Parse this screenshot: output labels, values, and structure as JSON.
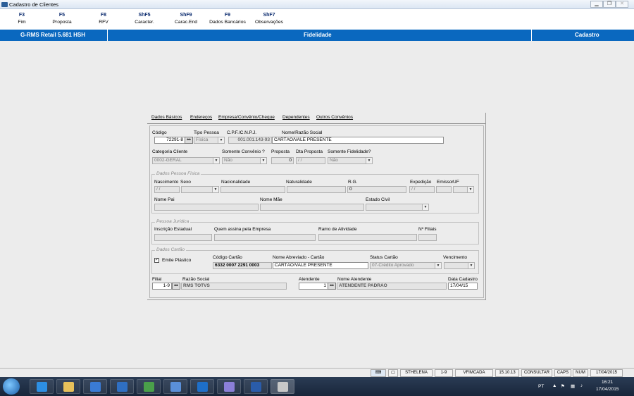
{
  "window": {
    "title": "Cadastro de Clientes"
  },
  "fkeys": [
    {
      "key": "F3",
      "label": "Fim"
    },
    {
      "key": "F5",
      "label": "Proposta"
    },
    {
      "key": "F8",
      "label": "RFV"
    },
    {
      "key": "ShF5",
      "label": "Caracter."
    },
    {
      "key": "ShF9",
      "label": "Carac.End"
    },
    {
      "key": "F9",
      "label": "Dados Bancários"
    },
    {
      "key": "ShF7",
      "label": "Observações"
    }
  ],
  "header": {
    "app": "G-RMS Retail 5.681 HSH",
    "module": "Fidelidade",
    "mode": "Cadastro"
  },
  "tabs": [
    "Dados Básicos",
    "Endereços",
    "Empresa/Convênio/Cheque",
    "Dependentes",
    "Outros Convênios"
  ],
  "basic": {
    "codigo_label": "Código",
    "codigo": "72291-8",
    "tipo_label": "Tipo Pessoa",
    "tipo": "Física",
    "cpf_label": "C.P.F./C.N.P.J.",
    "cpf": "001.001.143-93",
    "nome_label": "Nome/Razão Social",
    "nome": "CARTÃO/VALE PRESENTE",
    "categoria_label": "Categoria Cliente",
    "categoria": "0002-GERAL",
    "convenio_label": "Somente Convênio ?",
    "convenio": "Não",
    "proposta_label": "Proposta",
    "proposta": "0",
    "dtproposta_label": "Dta Proposta",
    "dtproposta": "/ /",
    "fidelidade_label": "Somente Fidelidade?",
    "fidelidade": "Não"
  },
  "pf": {
    "title": "Dados Pessoa Física",
    "nascimento_label": "Nascimento",
    "nascimento": "/ /",
    "sexo_label": "Sexo",
    "nacionalidade_label": "Nacionalidade",
    "naturalidade_label": "Naturalidade",
    "rg_label": "R.G.",
    "rg": "0",
    "expedicao_label": "Expedição",
    "expedicao": "/ /",
    "emissor_label": "Emissor",
    "uf_label": "UF",
    "pai_label": "Nome Pai",
    "mae_label": "Nome Mãe",
    "civil_label": "Estado Civil"
  },
  "pj": {
    "title": "Pessoa Jurídica",
    "ie_label": "Inscrição Estadual",
    "assina_label": "Quem assina pela Empresa",
    "ramo_label": "Ramo de Atividade",
    "filiais_label": "Nº Filiais"
  },
  "cartao": {
    "title": "Dados Cartão",
    "emite_label": "Emite Plástico",
    "codigo_label": "Código Cartão",
    "codigo": "6332 0007 2291 0003",
    "abrev_label": "Nome Abreviado - Cartão",
    "abrev": "CARTÃO/VALE PRESENTE",
    "status_label": "Status Cartão",
    "status": "07-Crédito Aprovado",
    "venc_label": "Vencimento"
  },
  "footer": {
    "filial_label": "Filial",
    "filial": "1-9",
    "razao_label": "Razão Social",
    "razao": "RMS TOTVS",
    "atendente_label": "Atendente",
    "atendente": "1",
    "nomeatend_label": "Nome Atendente",
    "nomeatend": "ATENDENTE PADRAO",
    "data_label": "Data Cadastro",
    "data": "17/04/15"
  },
  "status": {
    "user": "STHELENA",
    "store": "1-9",
    "program": "VFIMCADA",
    "version": "15.10.13",
    "mode": "CONSULTAR",
    "caps": "CAPS",
    "num": "NUM",
    "date": "17/04/2015"
  },
  "tray": {
    "lang": "PT",
    "time": "16:21",
    "date": "17/04/2015"
  },
  "colors": {
    "header_bg": "#0a68bf",
    "fkey": "#0a2a6e",
    "taskbar": "#1f2f45"
  }
}
